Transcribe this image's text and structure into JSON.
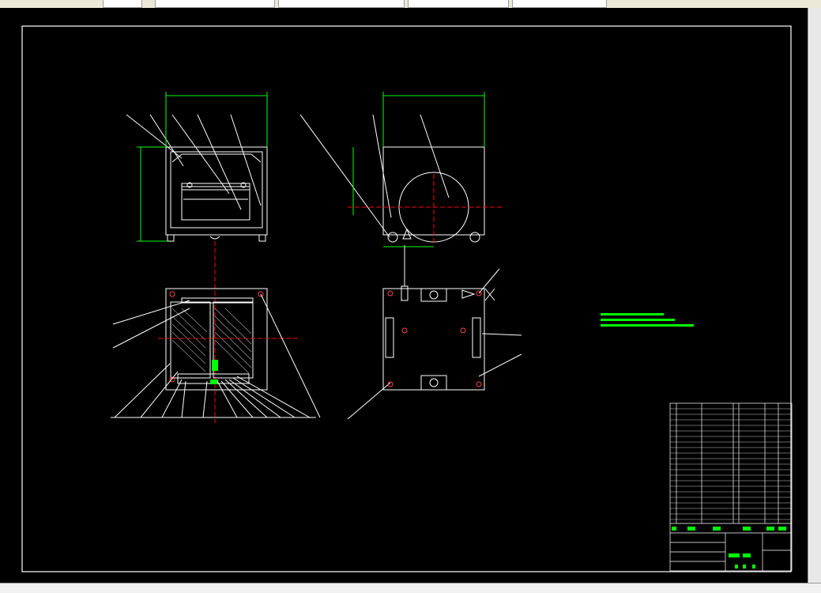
{
  "window": {
    "title": ""
  },
  "tabs": [
    {
      "label": ""
    },
    {
      "label": ""
    },
    {
      "label": ""
    },
    {
      "label": ""
    }
  ],
  "drawing": {
    "technical_requirements_title": "",
    "colors": {
      "background": "#000000",
      "lines": "#ffffff",
      "dimensions": "#00ff00",
      "centerlines": "#ff0000",
      "text_highlight": "#00ff00"
    }
  },
  "title_block": {
    "header_labels": [
      "",
      "",
      "",
      ""
    ],
    "drawing_name": "",
    "scale": ""
  },
  "status": {
    "text": ""
  }
}
